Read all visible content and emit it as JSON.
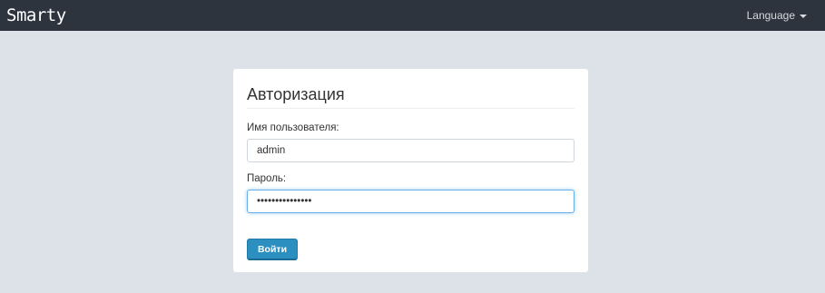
{
  "navbar": {
    "brand": "Smarty",
    "language_label": "Language"
  },
  "login": {
    "title": "Авторизация",
    "username_label": "Имя пользователя:",
    "username_value": "admin",
    "password_label": "Пароль:",
    "password_value": "•••••••••••••••",
    "submit_label": "Войти"
  },
  "colors": {
    "navbar_bg": "#2d343e",
    "page_bg": "#dde1e8",
    "button_bg": "#2b8fc0",
    "focus_border": "#66afe9"
  },
  "icons": {
    "language_caret": "caret-down-icon"
  }
}
